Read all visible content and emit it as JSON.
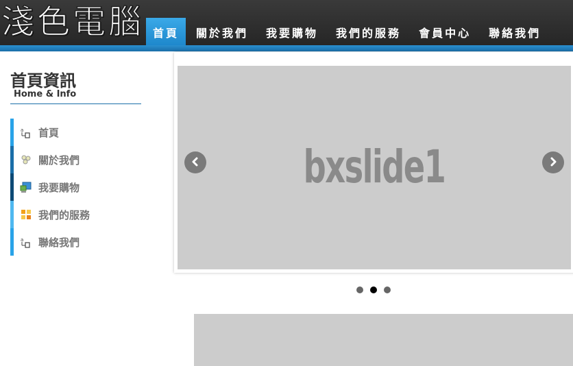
{
  "header": {
    "logo_text": "淺色電腦",
    "nav": [
      {
        "label": "首頁",
        "active": true
      },
      {
        "label": "關於我們",
        "active": false
      },
      {
        "label": "我要購物",
        "active": false
      },
      {
        "label": "我們的服務",
        "active": false
      },
      {
        "label": "會員中心",
        "active": false
      },
      {
        "label": "聯絡我們",
        "active": false
      }
    ]
  },
  "sidebar": {
    "title": "首頁資訊",
    "subtitle": "Home & Info",
    "items": [
      {
        "label": "首頁",
        "icon": "sitemap-icon",
        "edge_color": "#29a3e8"
      },
      {
        "label": "關於我們",
        "icon": "puzzle-icon",
        "edge_color": "#1a6ea8"
      },
      {
        "label": "我要購物",
        "icon": "shop-icon",
        "edge_color": "#0d4a75"
      },
      {
        "label": "我們的服務",
        "icon": "services-grid-icon",
        "edge_color": "#4fb8f0"
      },
      {
        "label": "聯絡我們",
        "icon": "sitemap-icon",
        "edge_color": "#29a3e8"
      }
    ]
  },
  "slider": {
    "slide_text": "bxslide1",
    "pager": {
      "count": 3,
      "active_index": 1
    }
  },
  "colors": {
    "accent": "#1e88cc",
    "header_bg": "#2f2f2f",
    "slide_bg": "#cccccc"
  }
}
